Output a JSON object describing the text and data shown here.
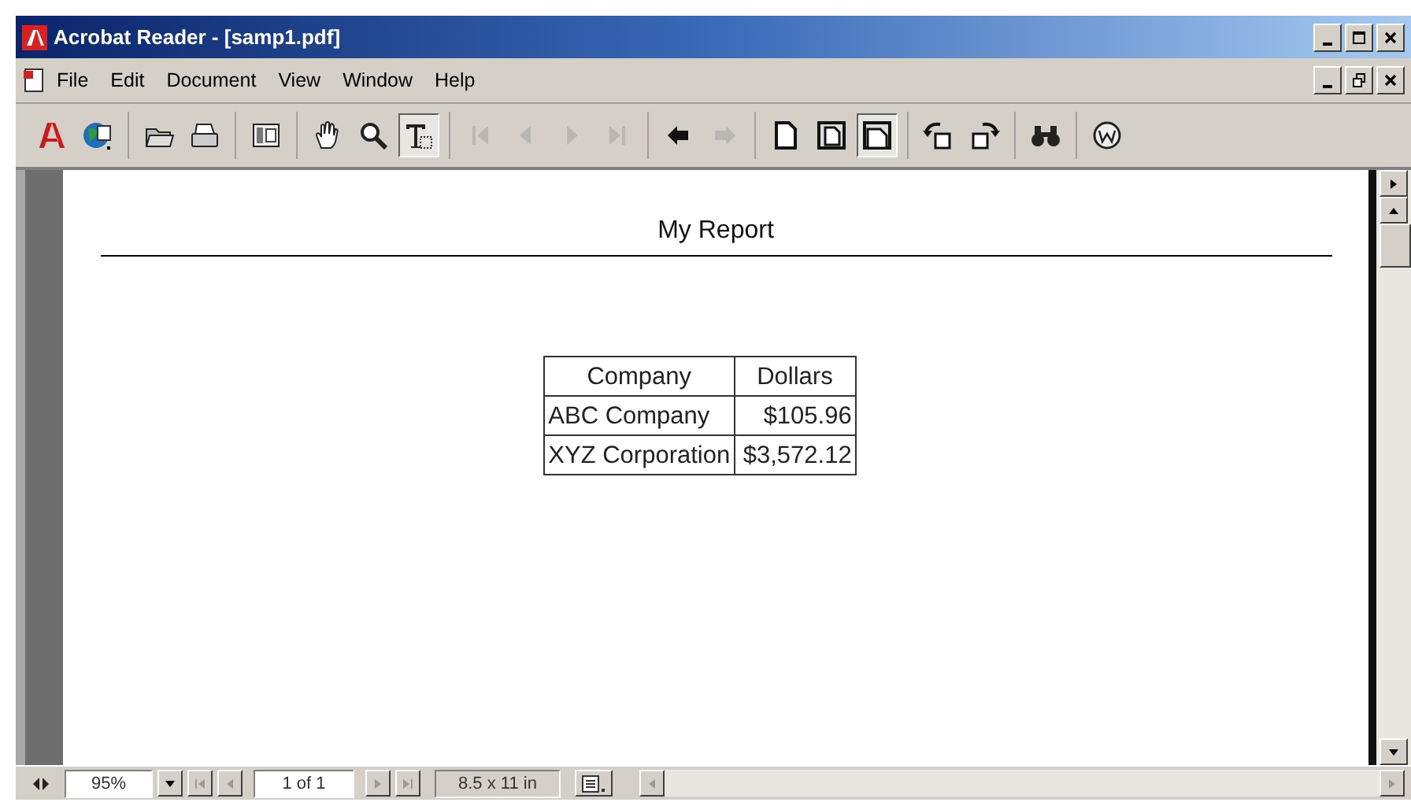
{
  "window": {
    "title": "Acrobat Reader - [samp1.pdf]"
  },
  "menu": [
    "File",
    "Edit",
    "Document",
    "View",
    "Window",
    "Help"
  ],
  "toolbar": [
    [
      {
        "kind": "acrobat",
        "pressed": false,
        "disabled": false
      },
      {
        "kind": "web",
        "pressed": false,
        "disabled": false
      }
    ],
    [
      {
        "kind": "open",
        "pressed": false,
        "disabled": false
      },
      {
        "kind": "print",
        "pressed": false,
        "disabled": false
      }
    ],
    [
      {
        "kind": "pane",
        "pressed": false,
        "disabled": false
      }
    ],
    [
      {
        "kind": "hand",
        "pressed": false,
        "disabled": false
      },
      {
        "kind": "zoom",
        "pressed": false,
        "disabled": false
      },
      {
        "kind": "text",
        "pressed": true,
        "disabled": false
      }
    ],
    [
      {
        "kind": "first",
        "pressed": false,
        "disabled": true
      },
      {
        "kind": "prev",
        "pressed": false,
        "disabled": true
      },
      {
        "kind": "next",
        "pressed": false,
        "disabled": true
      },
      {
        "kind": "last",
        "pressed": false,
        "disabled": true
      }
    ],
    [
      {
        "kind": "back",
        "pressed": false,
        "disabled": false
      },
      {
        "kind": "forward",
        "pressed": false,
        "disabled": true
      }
    ],
    [
      {
        "kind": "page",
        "pressed": false,
        "disabled": false
      },
      {
        "kind": "page-fit",
        "pressed": false,
        "disabled": false
      },
      {
        "kind": "page-width",
        "pressed": true,
        "disabled": false
      }
    ],
    [
      {
        "kind": "rotate-left",
        "pressed": false,
        "disabled": false
      },
      {
        "kind": "rotate-right",
        "pressed": false,
        "disabled": false
      }
    ],
    [
      {
        "kind": "find",
        "pressed": false,
        "disabled": false
      }
    ],
    [
      {
        "kind": "web-w",
        "pressed": false,
        "disabled": false
      }
    ]
  ],
  "document": {
    "heading": "My Report",
    "table": {
      "columns": [
        "Company",
        "Dollars"
      ],
      "rows": [
        [
          "ABC Company",
          "$105.96"
        ],
        [
          "XYZ Corporation",
          "$3,572.12"
        ]
      ]
    }
  },
  "status_bar": {
    "zoom": "95%",
    "page": "1 of 1",
    "page_size": "8.5 x 11 in"
  }
}
